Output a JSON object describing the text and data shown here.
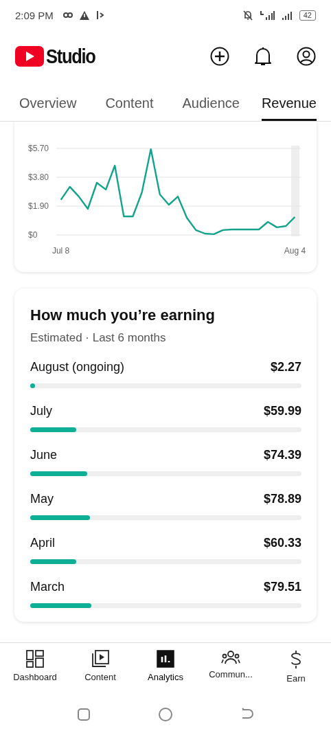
{
  "status_bar": {
    "time": "2:09 PM",
    "battery": "42"
  },
  "header": {
    "logo_text": "Studio"
  },
  "tabs": [
    {
      "label": "Overview",
      "selected": false
    },
    {
      "label": "Content",
      "selected": false
    },
    {
      "label": "Audience",
      "selected": false
    },
    {
      "label": "Revenue",
      "selected": true
    }
  ],
  "revenue_chart": {
    "chart_data": {
      "type": "line",
      "categories": [
        "Jul 8",
        null,
        null,
        null,
        null,
        null,
        null,
        null,
        null,
        null,
        null,
        null,
        null,
        null,
        null,
        null,
        null,
        null,
        null,
        null,
        null,
        null,
        null,
        null,
        null,
        null,
        "Aug 4"
      ],
      "series": [
        {
          "color": "#12a38c",
          "values": [
            2.31,
            3.17,
            2.53,
            1.72,
            3.44,
            2.99,
            4.57,
            1.22,
            1.22,
            2.8,
            5.65,
            2.67,
            1.99,
            2.53,
            1.13,
            0.32,
            0.09,
            0.05,
            0.32,
            0.36,
            0.36,
            0.36,
            0.36,
            0.86,
            0.5,
            0.59,
            1.18
          ]
        }
      ],
      "ylim": [
        0,
        5.7
      ],
      "yticks": [
        {
          "value": 0,
          "label": "$0"
        },
        {
          "value": 1.9,
          "label": "$1.90"
        },
        {
          "value": 3.8,
          "label": "$3.80"
        },
        {
          "value": 5.7,
          "label": "$5.70"
        }
      ]
    }
  },
  "earnings": {
    "title": "How much you’re earning",
    "subtitle": "Estimated · Last 6 months",
    "months": [
      {
        "month": "August (ongoing)",
        "amount": "$2.27",
        "level": 0.01
      },
      {
        "month": "July",
        "amount": "$59.99",
        "level": 0.17
      },
      {
        "month": "June",
        "amount": "$74.39",
        "level": 0.21
      },
      {
        "month": "May",
        "amount": "$78.89",
        "level": 0.22
      },
      {
        "month": "April",
        "amount": "$60.33",
        "level": 0.17
      },
      {
        "month": "March",
        "amount": "$79.51",
        "level": 0.225
      }
    ]
  },
  "bottom_nav": [
    {
      "label": "Dashboard",
      "kind": "dashboard",
      "selected": false
    },
    {
      "label": "Content",
      "kind": "content",
      "selected": false
    },
    {
      "label": "Analytics",
      "kind": "analytics",
      "selected": true
    },
    {
      "label": "Commun...",
      "kind": "community",
      "selected": false
    },
    {
      "label": "Earn",
      "kind": "earn",
      "selected": false
    }
  ]
}
